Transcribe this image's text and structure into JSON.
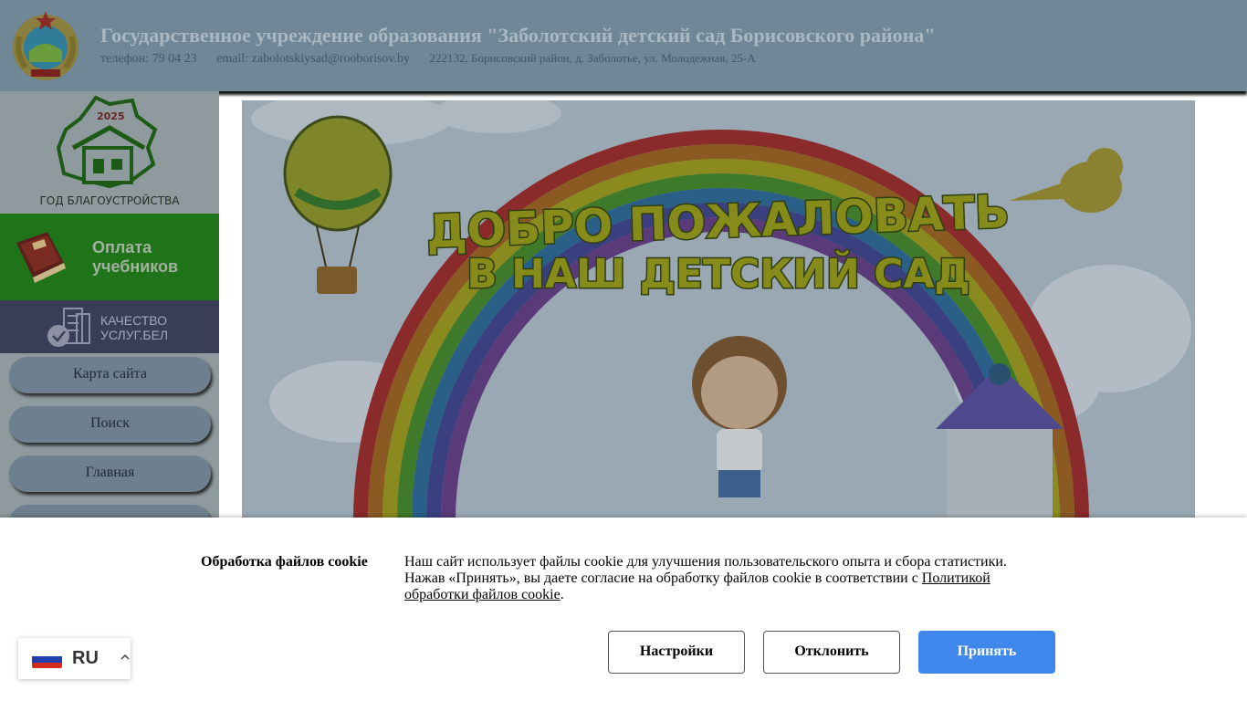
{
  "header": {
    "title": "Государственное учреждение образования \"Заболотский детский сад Борисовского района\"",
    "phone": "телефон: 79 04 23",
    "email": "email: zabolotskiysad@rooborisov.by",
    "address": "222132, Борисовский район, д. Заболотье, ул. Молодежная, 25-А",
    "emblem_icon": "state-emblem-icon"
  },
  "sidebar": {
    "year_logo": {
      "year": "2025",
      "caption": "ГОД БЛАГОУСТРОЙСТВА"
    },
    "pay_textbooks": {
      "line1": "Оплата",
      "line2": "учебников",
      "icon": "textbook-icon"
    },
    "quality": {
      "line1": "КАЧЕСТВО",
      "line2": "УСЛУГ.БЕЛ",
      "icon": "building-check-icon"
    },
    "nav": [
      {
        "label": "Карта сайта"
      },
      {
        "label": "Поиск"
      },
      {
        "label": "Главная"
      },
      {
        "label": ""
      }
    ]
  },
  "banner": {
    "line1": "ДОБРО ПОЖАЛОВАТЬ",
    "line2": "В НАШ ДЕТСКИЙ САД"
  },
  "cookie": {
    "title": "Обработка файлов cookie",
    "text_part1": "Наш сайт использует файлы cookie для улучшения пользовательского опыта и сбора статистики. Нажав «Принять», вы даете согласие на обработку файлов cookie в соответствии с ",
    "link_text": "Политикой обработки файлов cookie",
    "text_part2": ".",
    "buttons": {
      "settings": "Настройки",
      "decline": "Отклонить",
      "accept": "Принять"
    }
  },
  "language": {
    "code": "RU",
    "flag": "russia-flag-icon"
  },
  "colors": {
    "header_bg": "#6f8797",
    "pay_bg": "#1f741a",
    "quality_bg": "#3a3d56",
    "accept_button": "#3f87ea"
  }
}
